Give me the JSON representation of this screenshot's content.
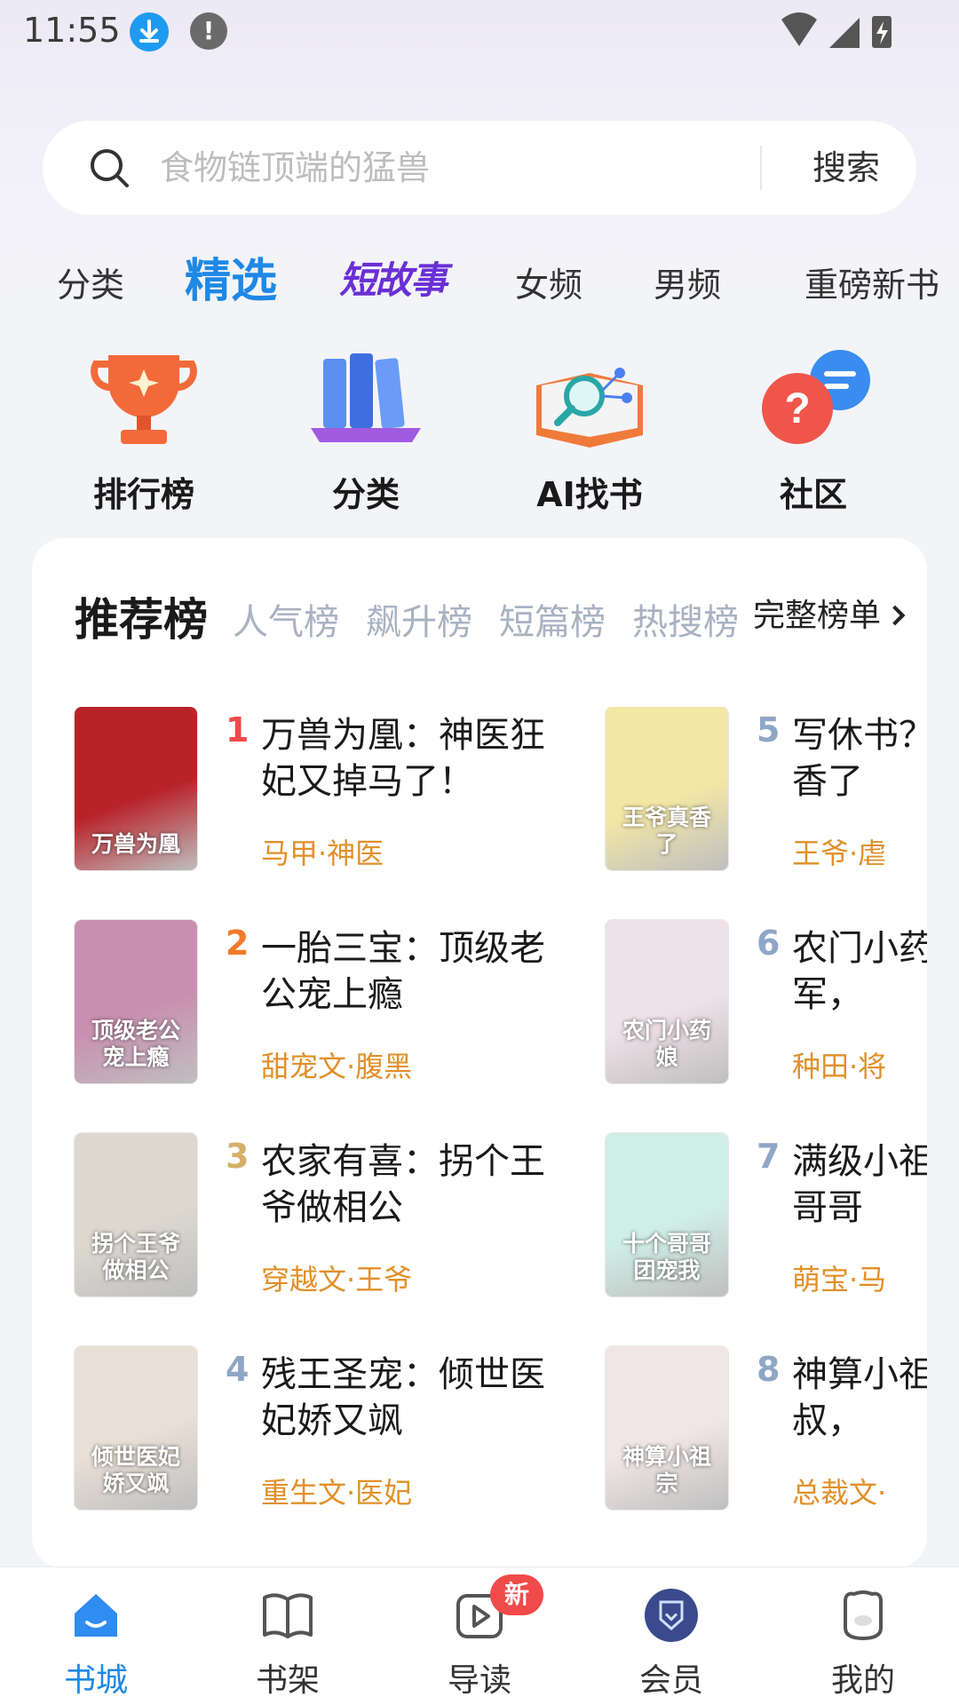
{
  "status_bar": {
    "time": "11:55"
  },
  "search": {
    "placeholder": "食物链顶端的猛兽",
    "button_label": "搜索"
  },
  "tabs": [
    {
      "label": "分类"
    },
    {
      "label": "精选"
    },
    {
      "label": "短故事"
    },
    {
      "label": "女频"
    },
    {
      "label": "男频"
    },
    {
      "label": "重磅新书"
    }
  ],
  "quick_nav": [
    {
      "label": "排行榜",
      "icon": "trophy-icon"
    },
    {
      "label": "分类",
      "icon": "books-icon"
    },
    {
      "label": "AI找书",
      "icon": "ai-search-book-icon"
    },
    {
      "label": "社区",
      "icon": "chat-bubbles-icon"
    }
  ],
  "rank": {
    "tabs": [
      {
        "label": "推荐榜"
      },
      {
        "label": "人气榜"
      },
      {
        "label": "飙升榜"
      },
      {
        "label": "短篇榜"
      },
      {
        "label": "热搜榜"
      }
    ],
    "full_list_label": "完整榜单",
    "books": [
      {
        "rank": "1",
        "title": "万兽为凰：神医狂妃又掉马了！",
        "tags": "马甲·神医",
        "cover_text": "万兽为凰",
        "cover_color": "#b8232a"
      },
      {
        "rank": "2",
        "title": "一胎三宝：顶级老公宠上瘾",
        "tags": "甜宠文·腹黑",
        "cover_text": "顶级老公宠上瘾",
        "cover_color": "#c98fb0"
      },
      {
        "rank": "3",
        "title": "农家有喜：拐个王爷做相公",
        "tags": "穿越文·王爷",
        "cover_text": "拐个王爷做相公",
        "cover_color": "#dcd8d0"
      },
      {
        "rank": "4",
        "title": "残王圣宠：倾世医妃娇又飒",
        "tags": "重生文·医妃",
        "cover_text": "倾世医妃娇又飒",
        "cover_color": "#e8dfd6"
      },
      {
        "rank": "5",
        "title": "写休书？王爷他真香了",
        "tags": "王爷·虐",
        "cover_text": "王爷真香了",
        "cover_color": "#f3e7a6"
      },
      {
        "rank": "6",
        "title": "农门小药娘：将军，",
        "tags": "种田·将",
        "cover_text": "农门小药娘",
        "cover_color": "#efe1e8"
      },
      {
        "rank": "7",
        "title": "满级小祖宗：十个哥哥",
        "tags": "萌宝·马",
        "cover_text": "十个哥哥团宠我",
        "cover_color": "#cfeee6"
      },
      {
        "rank": "8",
        "title": "神算小祖宗：大叔，",
        "tags": "总裁文·",
        "cover_text": "神算小祖宗",
        "cover_color": "#f1e6e6"
      }
    ]
  },
  "bottom_nav": [
    {
      "label": "书城",
      "icon": "home-icon",
      "active": true
    },
    {
      "label": "书架",
      "icon": "book-open-icon",
      "active": false
    },
    {
      "label": "导读",
      "icon": "play-book-icon",
      "active": false,
      "badge": "新"
    },
    {
      "label": "会员",
      "icon": "vip-shield-icon",
      "active": false
    },
    {
      "label": "我的",
      "icon": "profile-bear-icon",
      "active": false
    }
  ],
  "colors": {
    "accent": "#1e88e5",
    "tag": "#e0902a",
    "rank1": "#f04a4a",
    "badge": "#f04a4a"
  }
}
